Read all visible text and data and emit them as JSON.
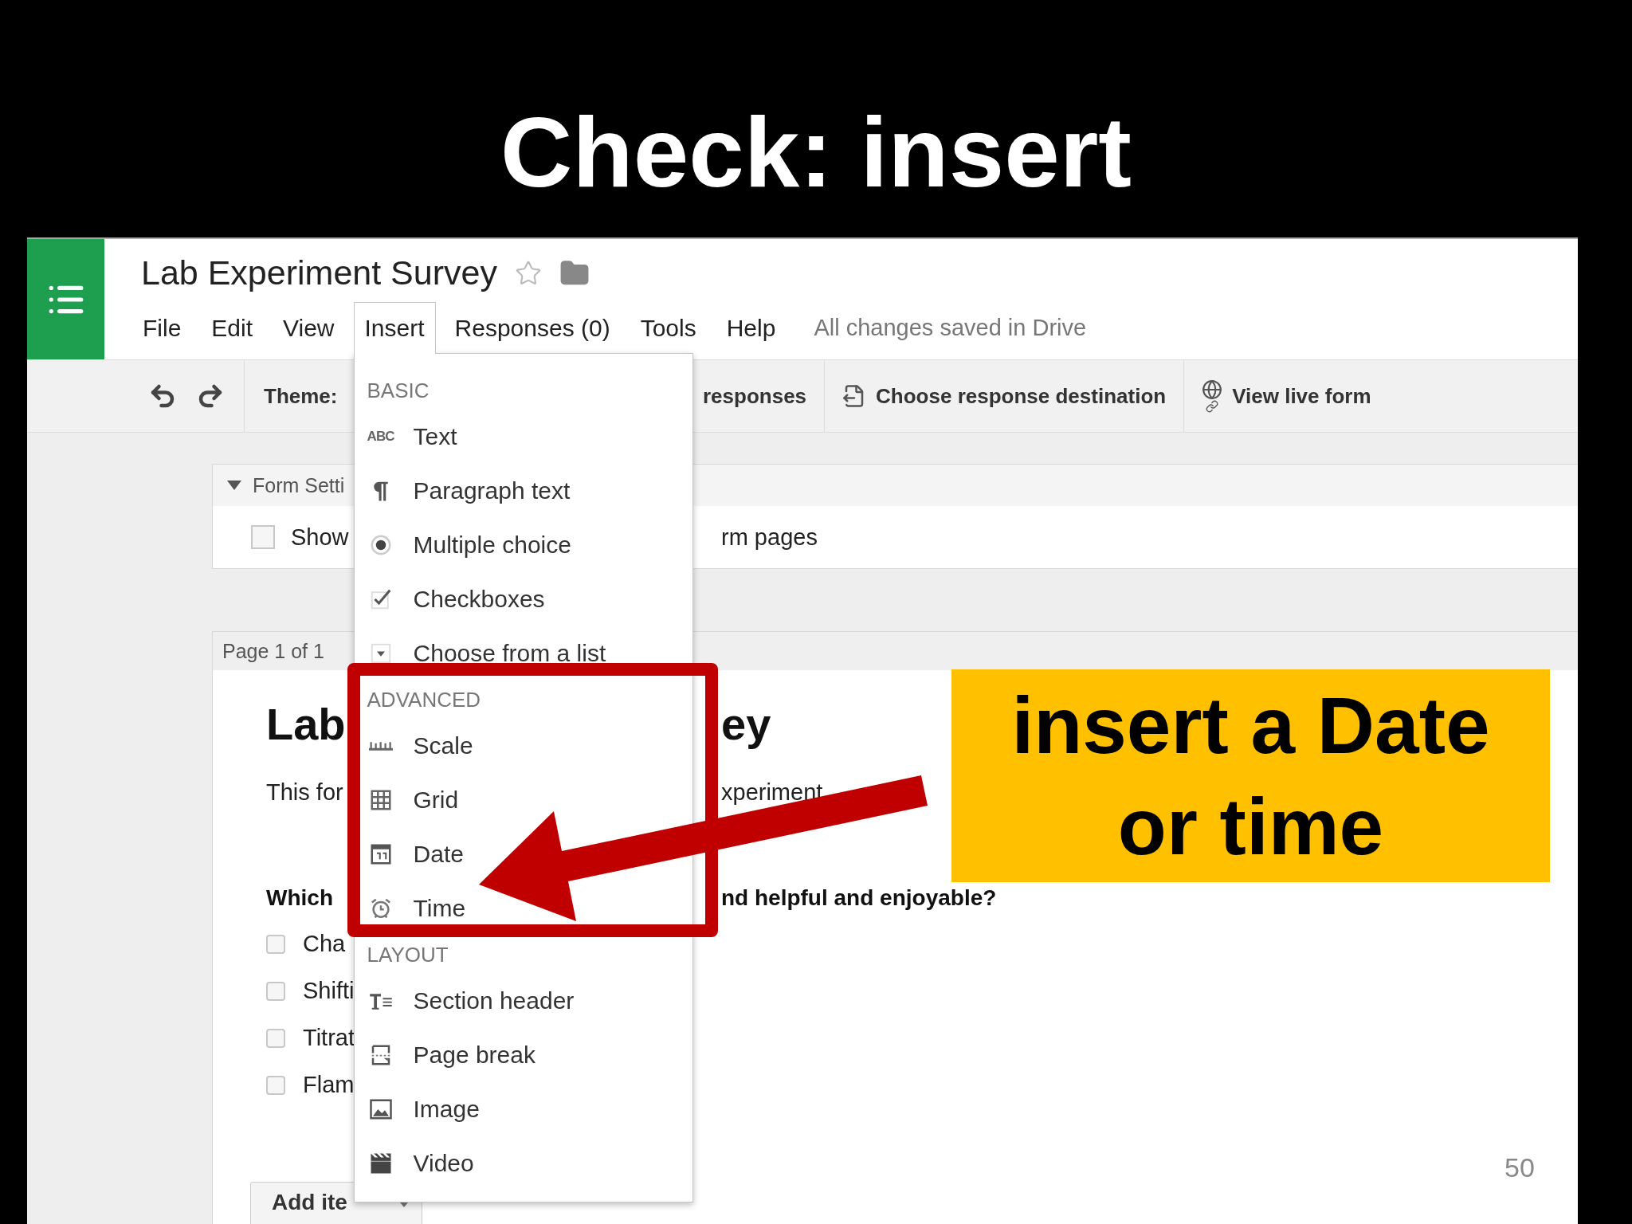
{
  "slide": {
    "title": "Check: insert",
    "page_number": "50"
  },
  "app": {
    "title": "Lab Experiment Survey",
    "starred": false,
    "menu_bar": [
      {
        "label": "File",
        "selected": false
      },
      {
        "label": "Edit",
        "selected": false
      },
      {
        "label": "View",
        "selected": false
      },
      {
        "label": "Insert",
        "selected": true
      },
      {
        "label": "Responses (0)",
        "selected": false
      },
      {
        "label": "Tools",
        "selected": false
      },
      {
        "label": "Help",
        "selected": false
      }
    ],
    "save_status": "All changes saved in Drive",
    "toolbar": {
      "theme_label": "Theme:",
      "responses_fragment": "responses",
      "buttons": [
        {
          "kind": "destination",
          "label": "Choose response destination"
        },
        {
          "kind": "live",
          "label": "View live form"
        }
      ]
    },
    "insert_menu": {
      "sections": [
        {
          "heading": "BASIC",
          "items": [
            {
              "kind": "abc",
              "icon_label": "ABC",
              "label": "Text"
            },
            {
              "kind": "paragraph",
              "label": "Paragraph text"
            },
            {
              "kind": "radio",
              "label": "Multiple choice"
            },
            {
              "kind": "check",
              "label": "Checkboxes"
            },
            {
              "kind": "dropdown",
              "label": "Choose from a list"
            }
          ]
        },
        {
          "heading": "ADVANCED",
          "items": [
            {
              "kind": "scale",
              "label": "Scale"
            },
            {
              "kind": "grid",
              "label": "Grid"
            },
            {
              "kind": "date",
              "label": "Date"
            },
            {
              "kind": "time",
              "label": "Time"
            }
          ]
        },
        {
          "heading": "LAYOUT",
          "items": [
            {
              "kind": "section",
              "label": "Section header"
            },
            {
              "kind": "pagebreak",
              "label": "Page break"
            },
            {
              "kind": "image",
              "label": "Image"
            },
            {
              "kind": "video",
              "label": "Video"
            }
          ]
        }
      ]
    },
    "form_settings": {
      "heading": "Form Setti",
      "expanded": true,
      "option": {
        "checked": false,
        "label_start": "Show",
        "label_end": "rm pages"
      }
    },
    "page": {
      "tab": "Page 1 of 1",
      "title_start": "Lab",
      "title_end": "ey",
      "description_start": "This for",
      "description_end": "xperiment",
      "question_start": "Which",
      "question_end": "nd helpful and enjoyable?",
      "options": [
        {
          "label": "Cha",
          "checked": false
        },
        {
          "label": "Shifti",
          "checked": false
        },
        {
          "label": "Titrat",
          "checked": false
        },
        {
          "label": "Flam",
          "checked": false
        }
      ],
      "add_button": "Add ite"
    }
  },
  "callout": {
    "text": "insert a Date or time"
  }
}
